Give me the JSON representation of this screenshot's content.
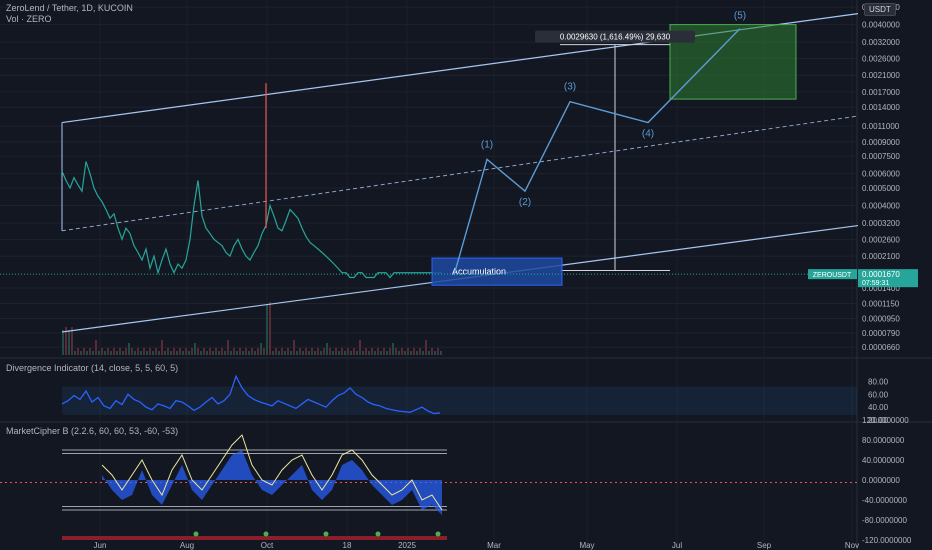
{
  "header": {
    "symbol_line": "ZeroLend / Tether, 1D, KUCOIN",
    "volume_line": "Vol · ZERO",
    "currency": "USDT"
  },
  "indicators": {
    "divergence": "Divergence Indicator (14, close, 5, 5, 60, 5)",
    "marketcipher": "MarketCipher B (2.2.6, 60, 60, 53, -60, -53)"
  },
  "chart_data": [
    {
      "type": "line",
      "name": "price",
      "scale": "log",
      "y_ticks": [
        "0.0050000",
        "0.0040000",
        "0.0032000",
        "0.0026000",
        "0.0021000",
        "0.0017000",
        "0.0014000",
        "0.0011000",
        "0.0009000",
        "0.0007500",
        "0.0006000",
        "0.0005000",
        "0.0004000",
        "0.0003200",
        "0.0002600",
        "0.0002100",
        "0.0001400",
        "0.0001150",
        "0.0000950",
        "0.0000790",
        "0.0000660"
      ],
      "x_ticks": [
        "Jun",
        "Aug",
        "Oct",
        "18",
        "2025",
        "Mar",
        "May",
        "Jul",
        "Sep",
        "Nov"
      ],
      "price_x": [
        0,
        4,
        8,
        12,
        16,
        20,
        24,
        28,
        32,
        36,
        40,
        44,
        48,
        52,
        56,
        60,
        64,
        68,
        72,
        76,
        80,
        84,
        88,
        92,
        96,
        100,
        104,
        108,
        112,
        116,
        120,
        124,
        128,
        132,
        136,
        140,
        144,
        148,
        152,
        156,
        160,
        164,
        168,
        172,
        176,
        180,
        184,
        188,
        192,
        196,
        200,
        204,
        208,
        212,
        216,
        220,
        224,
        228,
        232,
        236,
        240,
        244,
        248,
        252,
        256,
        260,
        264,
        268,
        272,
        276,
        280,
        284,
        288,
        292,
        296,
        300,
        304,
        308,
        312,
        316,
        320,
        324,
        328,
        332,
        336,
        340,
        344,
        348,
        352,
        356,
        360,
        364,
        368,
        372,
        376,
        380
      ],
      "price_y": [
        0.00062,
        0.00055,
        0.0005,
        0.00057,
        0.00052,
        0.00048,
        0.0007,
        0.0006,
        0.0005,
        0.00045,
        0.00042,
        0.00038,
        0.00034,
        0.00036,
        0.0003,
        0.00026,
        0.0003,
        0.00028,
        0.00024,
        0.00022,
        0.0002,
        0.00023,
        0.00018,
        0.00021,
        0.00017,
        0.0002,
        0.00023,
        0.00019,
        0.00017,
        0.00019,
        0.00018,
        0.0002,
        0.00026,
        0.0004,
        0.00055,
        0.00035,
        0.0003,
        0.00028,
        0.00026,
        0.00025,
        0.00024,
        0.00022,
        0.00021,
        0.00024,
        0.00026,
        0.00023,
        0.00021,
        0.0002,
        0.00022,
        0.00024,
        0.00028,
        0.00031,
        0.0004,
        0.00035,
        0.0003,
        0.00029,
        0.00033,
        0.00038,
        0.00036,
        0.00034,
        0.0003,
        0.00027,
        0.00025,
        0.00024,
        0.00023,
        0.00022,
        0.00021,
        0.0002,
        0.00019,
        0.00018,
        0.00017,
        0.00017,
        0.00016,
        0.00016,
        0.00017,
        0.00017,
        0.00016,
        0.00016,
        0.00016,
        0.00017,
        0.00017,
        0.00017,
        0.00016,
        0.00017,
        0.00017,
        0.00017,
        0.00017,
        0.00017,
        0.00017,
        0.00017,
        0.00017,
        0.00017,
        0.00017,
        0.00017,
        0.00017,
        0.00017
      ],
      "spikes": [
        {
          "x": 204,
          "high": 0.0019
        }
      ],
      "last_price": {
        "symbol": "ZEROUSDT",
        "value": "0.0001670",
        "countdown": "07:59:31"
      },
      "wave_labels": [
        "(1)",
        "(2)",
        "(3)",
        "(4)",
        "(5)"
      ],
      "wave_points": [
        {
          "x": 392,
          "y": 0.000165
        },
        {
          "x": 425,
          "y": 0.00072
        },
        {
          "x": 463,
          "y": 0.00048
        },
        {
          "x": 508,
          "y": 0.0015
        },
        {
          "x": 586,
          "y": 0.00115
        },
        {
          "x": 678,
          "y": 0.0038
        }
      ],
      "channel": {
        "upper": [
          {
            "x": 0,
            "y": 0.00115
          },
          {
            "x": 796,
            "y": 0.0046
          }
        ],
        "mid": [
          {
            "x": 0,
            "y": 0.00029
          },
          {
            "x": 796,
            "y": 0.00125
          }
        ],
        "lower": [
          {
            "x": 0,
            "y": 8e-05
          },
          {
            "x": 796,
            "y": 0.00031
          }
        ]
      },
      "accumulation": {
        "label": "Accumulation",
        "x0": 370,
        "x1": 500,
        "y0": 0.000145,
        "y1": 0.000205
      },
      "target_box": {
        "x0": 608,
        "x1": 734,
        "y0": 0.00155,
        "y1": 0.004
      },
      "measure": {
        "label": "0.0029630 (1,616.49%) 29,630",
        "x": 553,
        "y0": 0.000175,
        "y1": 0.0031
      }
    },
    {
      "type": "line",
      "name": "divergence",
      "ylim": [
        20,
        90
      ],
      "y_ticks": [
        "80.00",
        "60.00",
        "40.00",
        "20.00"
      ],
      "x": [
        0,
        6,
        12,
        18,
        24,
        30,
        36,
        42,
        48,
        54,
        60,
        66,
        72,
        78,
        84,
        90,
        96,
        102,
        108,
        114,
        120,
        126,
        132,
        138,
        144,
        150,
        156,
        162,
        168,
        174,
        180,
        186,
        192,
        198,
        204,
        210,
        216,
        222,
        228,
        234,
        240,
        246,
        252,
        258,
        264,
        270,
        276,
        282,
        288,
        294,
        300,
        306,
        312,
        318,
        324,
        330,
        336,
        342,
        348,
        354,
        360,
        366,
        372,
        378
      ],
      "values": [
        45,
        50,
        58,
        52,
        65,
        48,
        55,
        42,
        38,
        50,
        44,
        60,
        52,
        48,
        40,
        36,
        45,
        42,
        38,
        50,
        48,
        42,
        35,
        40,
        48,
        55,
        45,
        50,
        60,
        88,
        70,
        58,
        52,
        48,
        45,
        42,
        50,
        46,
        42,
        38,
        45,
        52,
        48,
        44,
        40,
        50,
        58,
        62,
        70,
        60,
        55,
        48,
        44,
        42,
        38,
        36,
        34,
        33,
        32,
        36,
        40,
        34,
        30,
        31
      ]
    },
    {
      "type": "area",
      "name": "marketcipher",
      "ylim": [
        -120,
        120
      ],
      "y_ticks": [
        "120.0000000",
        "80.0000000",
        "40.0000000",
        "0.0000000",
        "-40.0000000",
        "-80.0000000",
        "-120.0000000"
      ],
      "x": [
        40,
        50,
        60,
        70,
        80,
        90,
        100,
        110,
        120,
        130,
        140,
        150,
        160,
        170,
        180,
        190,
        200,
        210,
        220,
        230,
        240,
        250,
        260,
        270,
        280,
        290,
        300,
        310,
        320,
        330,
        340,
        350,
        360,
        370,
        380
      ],
      "wave1": [
        10,
        -20,
        -40,
        -30,
        20,
        -30,
        -50,
        -10,
        30,
        -20,
        -40,
        -10,
        20,
        50,
        60,
        10,
        -20,
        -30,
        -10,
        10,
        30,
        -20,
        -40,
        -20,
        30,
        40,
        20,
        -10,
        -30,
        -50,
        -40,
        -20,
        -60,
        -50,
        -70
      ],
      "wave2": [
        30,
        10,
        -20,
        10,
        40,
        0,
        -30,
        20,
        50,
        0,
        -20,
        10,
        40,
        70,
        90,
        30,
        0,
        -10,
        20,
        40,
        50,
        10,
        -20,
        10,
        50,
        60,
        40,
        10,
        -10,
        -30,
        -20,
        0,
        -40,
        -30,
        -60
      ]
    }
  ]
}
